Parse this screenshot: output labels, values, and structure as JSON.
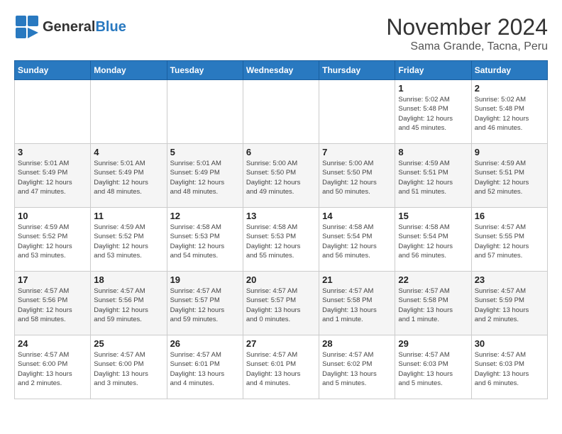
{
  "logo": {
    "text_general": "General",
    "text_blue": "Blue",
    "icon": "▶"
  },
  "title": "November 2024",
  "subtitle": "Sama Grande, Tacna, Peru",
  "days_of_week": [
    "Sunday",
    "Monday",
    "Tuesday",
    "Wednesday",
    "Thursday",
    "Friday",
    "Saturday"
  ],
  "weeks": [
    [
      {
        "day": "",
        "info": ""
      },
      {
        "day": "",
        "info": ""
      },
      {
        "day": "",
        "info": ""
      },
      {
        "day": "",
        "info": ""
      },
      {
        "day": "",
        "info": ""
      },
      {
        "day": "1",
        "info": "Sunrise: 5:02 AM\nSunset: 5:48 PM\nDaylight: 12 hours\nand 45 minutes."
      },
      {
        "day": "2",
        "info": "Sunrise: 5:02 AM\nSunset: 5:48 PM\nDaylight: 12 hours\nand 46 minutes."
      }
    ],
    [
      {
        "day": "3",
        "info": "Sunrise: 5:01 AM\nSunset: 5:49 PM\nDaylight: 12 hours\nand 47 minutes."
      },
      {
        "day": "4",
        "info": "Sunrise: 5:01 AM\nSunset: 5:49 PM\nDaylight: 12 hours\nand 48 minutes."
      },
      {
        "day": "5",
        "info": "Sunrise: 5:01 AM\nSunset: 5:49 PM\nDaylight: 12 hours\nand 48 minutes."
      },
      {
        "day": "6",
        "info": "Sunrise: 5:00 AM\nSunset: 5:50 PM\nDaylight: 12 hours\nand 49 minutes."
      },
      {
        "day": "7",
        "info": "Sunrise: 5:00 AM\nSunset: 5:50 PM\nDaylight: 12 hours\nand 50 minutes."
      },
      {
        "day": "8",
        "info": "Sunrise: 4:59 AM\nSunset: 5:51 PM\nDaylight: 12 hours\nand 51 minutes."
      },
      {
        "day": "9",
        "info": "Sunrise: 4:59 AM\nSunset: 5:51 PM\nDaylight: 12 hours\nand 52 minutes."
      }
    ],
    [
      {
        "day": "10",
        "info": "Sunrise: 4:59 AM\nSunset: 5:52 PM\nDaylight: 12 hours\nand 53 minutes."
      },
      {
        "day": "11",
        "info": "Sunrise: 4:59 AM\nSunset: 5:52 PM\nDaylight: 12 hours\nand 53 minutes."
      },
      {
        "day": "12",
        "info": "Sunrise: 4:58 AM\nSunset: 5:53 PM\nDaylight: 12 hours\nand 54 minutes."
      },
      {
        "day": "13",
        "info": "Sunrise: 4:58 AM\nSunset: 5:53 PM\nDaylight: 12 hours\nand 55 minutes."
      },
      {
        "day": "14",
        "info": "Sunrise: 4:58 AM\nSunset: 5:54 PM\nDaylight: 12 hours\nand 56 minutes."
      },
      {
        "day": "15",
        "info": "Sunrise: 4:58 AM\nSunset: 5:54 PM\nDaylight: 12 hours\nand 56 minutes."
      },
      {
        "day": "16",
        "info": "Sunrise: 4:57 AM\nSunset: 5:55 PM\nDaylight: 12 hours\nand 57 minutes."
      }
    ],
    [
      {
        "day": "17",
        "info": "Sunrise: 4:57 AM\nSunset: 5:56 PM\nDaylight: 12 hours\nand 58 minutes."
      },
      {
        "day": "18",
        "info": "Sunrise: 4:57 AM\nSunset: 5:56 PM\nDaylight: 12 hours\nand 59 minutes."
      },
      {
        "day": "19",
        "info": "Sunrise: 4:57 AM\nSunset: 5:57 PM\nDaylight: 12 hours\nand 59 minutes."
      },
      {
        "day": "20",
        "info": "Sunrise: 4:57 AM\nSunset: 5:57 PM\nDaylight: 13 hours\nand 0 minutes."
      },
      {
        "day": "21",
        "info": "Sunrise: 4:57 AM\nSunset: 5:58 PM\nDaylight: 13 hours\nand 1 minute."
      },
      {
        "day": "22",
        "info": "Sunrise: 4:57 AM\nSunset: 5:58 PM\nDaylight: 13 hours\nand 1 minute."
      },
      {
        "day": "23",
        "info": "Sunrise: 4:57 AM\nSunset: 5:59 PM\nDaylight: 13 hours\nand 2 minutes."
      }
    ],
    [
      {
        "day": "24",
        "info": "Sunrise: 4:57 AM\nSunset: 6:00 PM\nDaylight: 13 hours\nand 2 minutes."
      },
      {
        "day": "25",
        "info": "Sunrise: 4:57 AM\nSunset: 6:00 PM\nDaylight: 13 hours\nand 3 minutes."
      },
      {
        "day": "26",
        "info": "Sunrise: 4:57 AM\nSunset: 6:01 PM\nDaylight: 13 hours\nand 4 minutes."
      },
      {
        "day": "27",
        "info": "Sunrise: 4:57 AM\nSunset: 6:01 PM\nDaylight: 13 hours\nand 4 minutes."
      },
      {
        "day": "28",
        "info": "Sunrise: 4:57 AM\nSunset: 6:02 PM\nDaylight: 13 hours\nand 5 minutes."
      },
      {
        "day": "29",
        "info": "Sunrise: 4:57 AM\nSunset: 6:03 PM\nDaylight: 13 hours\nand 5 minutes."
      },
      {
        "day": "30",
        "info": "Sunrise: 4:57 AM\nSunset: 6:03 PM\nDaylight: 13 hours\nand 6 minutes."
      }
    ]
  ]
}
